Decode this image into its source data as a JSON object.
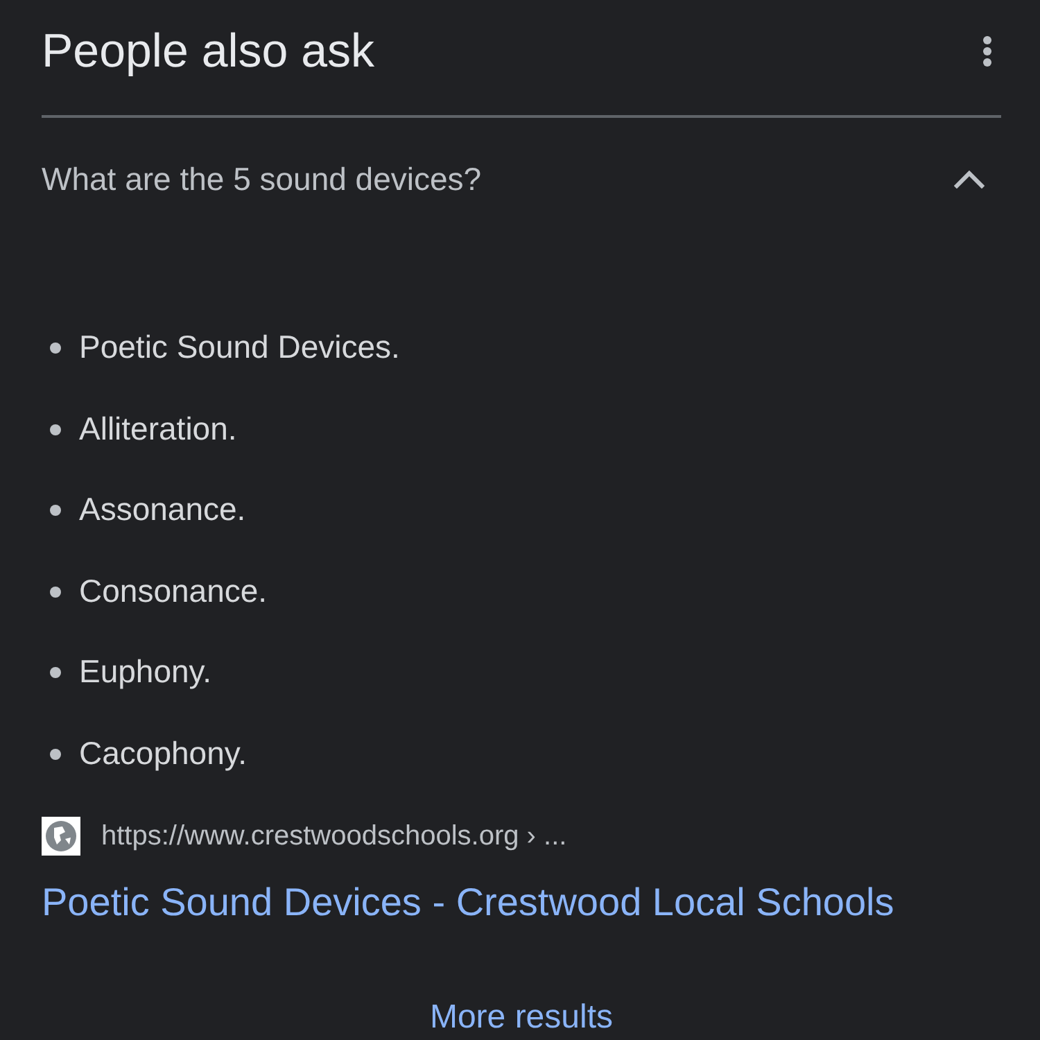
{
  "header": {
    "title": "People also ask"
  },
  "question": {
    "text": "What are the 5 sound devices?",
    "expanded": true
  },
  "answer": {
    "items": [
      "Poetic Sound Devices.",
      "Alliteration.",
      "Assonance.",
      "Consonance.",
      "Euphony.",
      "Cacophony."
    ]
  },
  "source": {
    "url": "https://www.crestwoodschools.org › ...",
    "title": "Poetic Sound Devices - Crestwood Local Schools"
  },
  "more_button": {
    "label": "More results"
  }
}
